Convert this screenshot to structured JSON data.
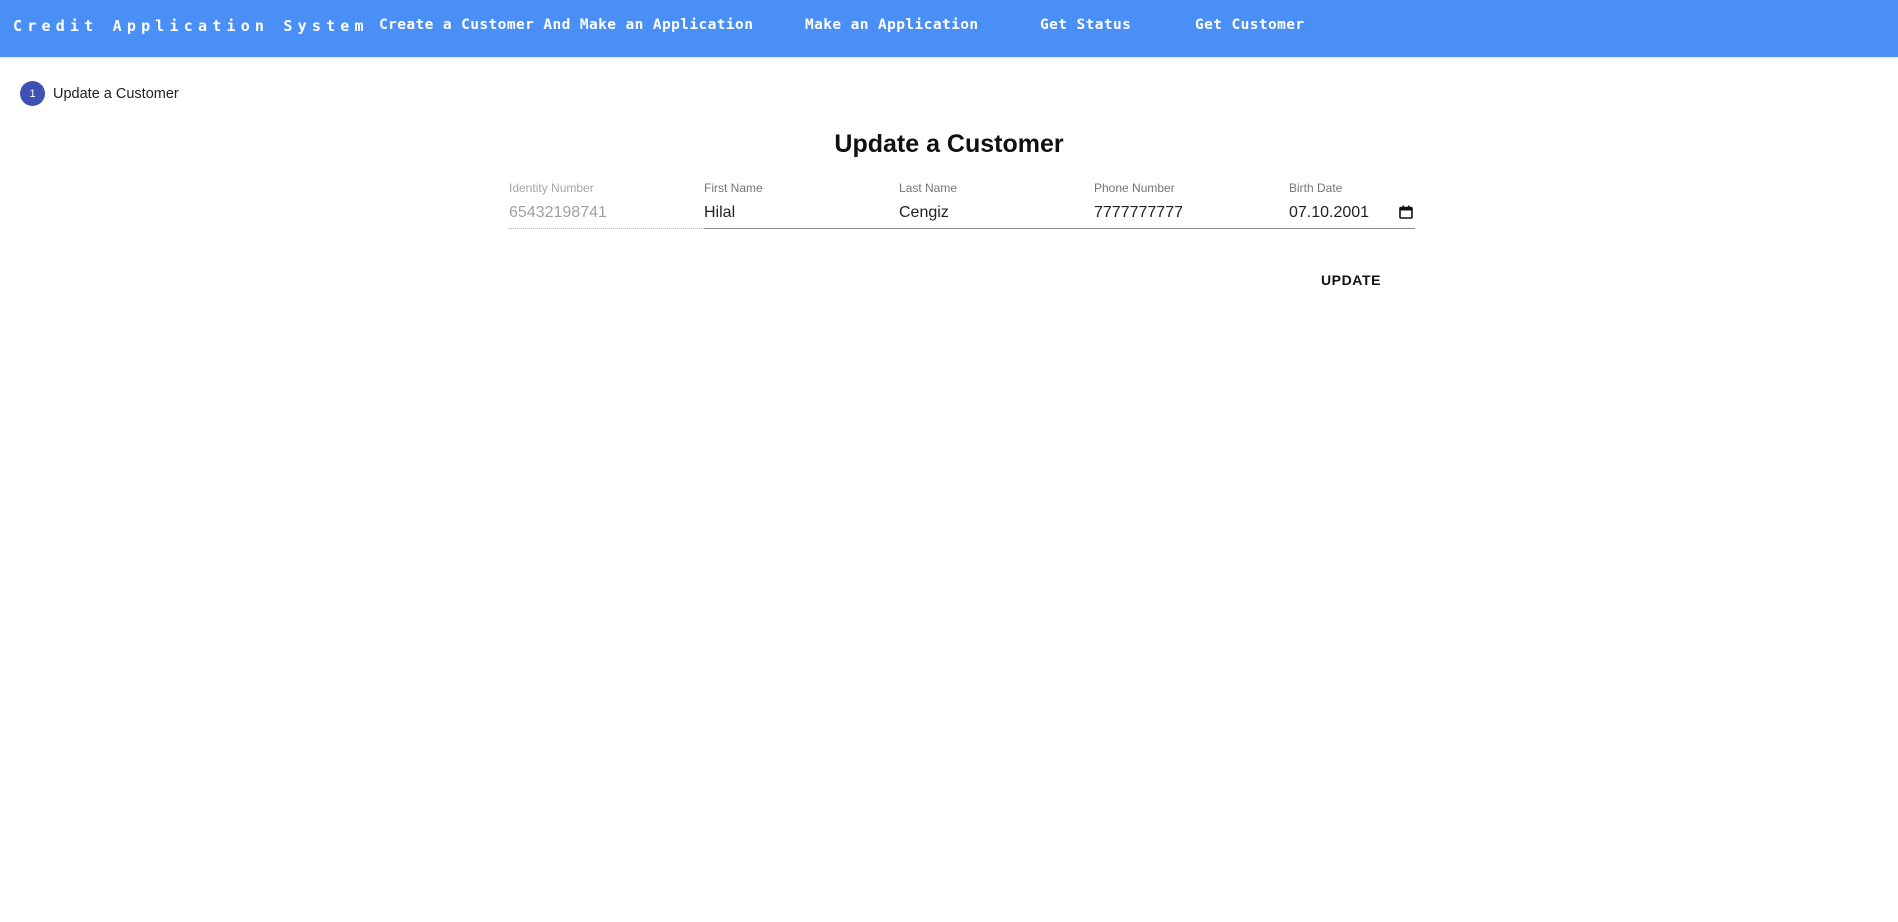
{
  "app": {
    "title": "Credit Application System",
    "brand_color": "#4a8ff5"
  },
  "nav": {
    "items": [
      {
        "label": "Create a Customer And Make an Application"
      },
      {
        "label": "Make an Application"
      },
      {
        "label": "Get Status"
      },
      {
        "label": "Get Customer"
      }
    ]
  },
  "stepper": {
    "step_number": "1",
    "step_label": "Update a Customer",
    "accent": "#3f51b5"
  },
  "form": {
    "title": "Update a Customer",
    "fields": {
      "identity": {
        "label": "Identity Number",
        "value": "65432198741",
        "disabled": true
      },
      "first_name": {
        "label": "First Name",
        "value": "Hilal"
      },
      "last_name": {
        "label": "Last Name",
        "value": "Cengiz"
      },
      "phone": {
        "label": "Phone Number",
        "value": "7777777777"
      },
      "birth_date": {
        "label": "Birth Date",
        "value": "07.10.2001",
        "icon": "calendar-icon"
      }
    },
    "submit_label": "UPDATE"
  }
}
